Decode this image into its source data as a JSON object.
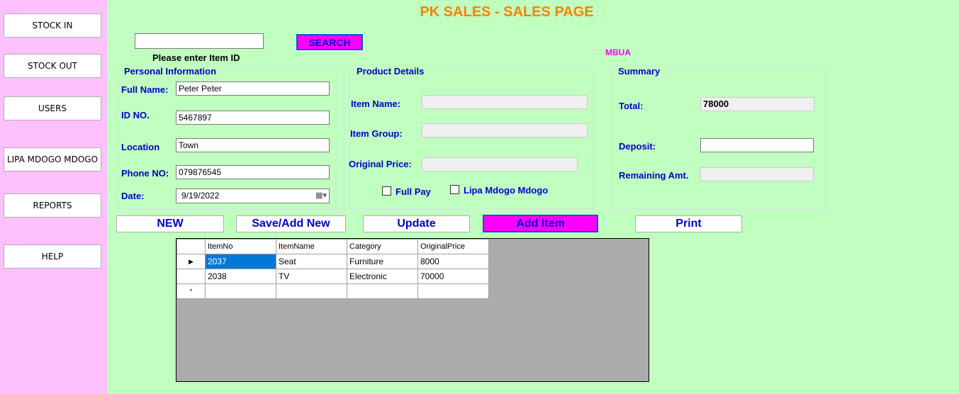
{
  "sidebar": {
    "items": [
      {
        "label": "STOCK IN"
      },
      {
        "label": "STOCK OUT"
      },
      {
        "label": "USERS"
      },
      {
        "label": "LIPA MDOGO MDOGO"
      },
      {
        "label": "REPORTS"
      },
      {
        "label": "HELP"
      }
    ]
  },
  "header": {
    "title": "PK SALES - SALES PAGE",
    "user": "MBUA"
  },
  "search": {
    "value": "",
    "button_label": "SEARCH",
    "hint": "Please enter Item ID"
  },
  "personal": {
    "title": "Personal Information",
    "full_name_label": "Full Name:",
    "full_name": "Peter Peter",
    "id_label": "ID NO.",
    "id": "5467897",
    "location_label": "Location",
    "location": "Town",
    "phone_label": "Phone NO:",
    "phone": "079876545",
    "date_label": "Date:",
    "date": "9/19/2022"
  },
  "product": {
    "title": "Product Details",
    "item_name_label": "Item Name:",
    "item_name": "",
    "item_group_label": "Item Group:",
    "item_group": "",
    "original_price_label": "Original Price:",
    "original_price": "",
    "full_pay_label": "Full Pay",
    "lipa_label": "Lipa Mdogo Mdogo"
  },
  "summary": {
    "title": "Summary",
    "total_label": "Total:",
    "total": "78000",
    "deposit_label": "Deposit:",
    "deposit": "",
    "remaining_label": "Remaining Amt.",
    "remaining": ""
  },
  "actions": {
    "new_label": "NEW",
    "save_label": "Save/Add New",
    "update_label": "Update",
    "add_item_label": "Add Item",
    "print_label": "Print"
  },
  "grid": {
    "columns": [
      "ItemNo",
      "ItemName",
      "Category",
      "OriginalPrice"
    ],
    "rows": [
      [
        "2037",
        "Seat",
        "Furniture",
        "8000"
      ],
      [
        "2038",
        "TV",
        "Electronic",
        "70000"
      ]
    ],
    "current_row_marker": "▶",
    "new_row_marker": "*"
  },
  "colors": {
    "sidebar_bg": "#ffc0ff",
    "page_bg": "#c0ffc0",
    "title": "#ff8000",
    "label": "#0000cc",
    "highlight": "#ff00ff"
  }
}
